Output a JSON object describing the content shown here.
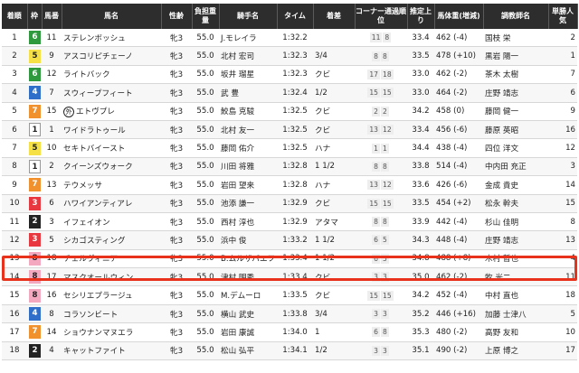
{
  "headers": {
    "rank": "着順",
    "waku": "枠",
    "umaban": "馬番",
    "horse": "馬名",
    "sexage": "性齢",
    "weight": "負担重量",
    "jockey": "騎手名",
    "time": "タイム",
    "margin": "着差",
    "corner": "コーナー通過順位",
    "agari": "推定上り",
    "body": "馬体重(増減)",
    "trainer": "調教師名",
    "pop": "単勝人気"
  },
  "rows": [
    {
      "rank": "1",
      "waku": "6",
      "umaban": "11",
      "name": "ステレンボッシュ",
      "sexage": "牝3",
      "weight": "55.0",
      "jockey": "J.モレイラ",
      "time": "1:32.2",
      "margin": "",
      "corner": [
        "11",
        "8"
      ],
      "agari": "33.4",
      "body": "462",
      "diff": "(-4)",
      "trainer": "国枝 栄",
      "pop": "2"
    },
    {
      "rank": "2",
      "waku": "5",
      "umaban": "9",
      "name": "アスコリピチェーノ",
      "sexage": "牝3",
      "weight": "55.0",
      "jockey": "北村 宏司",
      "time": "1:32.3",
      "margin": "3/4",
      "corner": [
        "8",
        "8"
      ],
      "agari": "33.5",
      "body": "478",
      "diff": "(+10)",
      "trainer": "黒岩 陽一",
      "pop": "1"
    },
    {
      "rank": "3",
      "waku": "6",
      "umaban": "12",
      "name": "ライトバック",
      "sexage": "牝3",
      "weight": "55.0",
      "jockey": "坂井 瑠星",
      "time": "1:32.3",
      "margin": "クビ",
      "corner": [
        "17",
        "18"
      ],
      "agari": "33.0",
      "body": "462",
      "diff": "(-2)",
      "trainer": "茶木 太樹",
      "pop": "7"
    },
    {
      "rank": "4",
      "waku": "4",
      "umaban": "7",
      "name": "スウィープフィート",
      "sexage": "牝3",
      "weight": "55.0",
      "jockey": "武 豊",
      "time": "1:32.4",
      "margin": "1/2",
      "corner": [
        "15",
        "15"
      ],
      "agari": "33.0",
      "body": "464",
      "diff": "(-2)",
      "trainer": "庄野 靖志",
      "pop": "6"
    },
    {
      "rank": "5",
      "waku": "7",
      "umaban": "15",
      "name": "エトヴプレ",
      "badge": "外",
      "sexage": "牝3",
      "weight": "55.0",
      "jockey": "鮫島 克駿",
      "time": "1:32.5",
      "margin": "クビ",
      "corner": [
        "2",
        "2"
      ],
      "agari": "34.2",
      "body": "458",
      "diff": "(0)",
      "trainer": "藤岡 健一",
      "pop": "9"
    },
    {
      "rank": "6",
      "waku": "1",
      "umaban": "1",
      "name": "ワイドラトゥール",
      "sexage": "牝3",
      "weight": "55.0",
      "jockey": "北村 友一",
      "time": "1:32.5",
      "margin": "クビ",
      "corner": [
        "13",
        "12"
      ],
      "agari": "33.4",
      "body": "456",
      "diff": "(-6)",
      "trainer": "藤原 英昭",
      "pop": "16"
    },
    {
      "rank": "7",
      "waku": "5",
      "umaban": "10",
      "name": "セキトバイースト",
      "sexage": "牝3",
      "weight": "55.0",
      "jockey": "藤岡 佑介",
      "time": "1:32.5",
      "margin": "ハナ",
      "corner": [
        "1",
        "1"
      ],
      "agari": "34.4",
      "body": "438",
      "diff": "(-4)",
      "trainer": "四位 洋文",
      "pop": "12"
    },
    {
      "rank": "8",
      "waku": "1",
      "umaban": "2",
      "name": "クイーンズウォーク",
      "sexage": "牝3",
      "weight": "55.0",
      "jockey": "川田 将雅",
      "time": "1:32.8",
      "margin": "1 1/2",
      "corner": [
        "8",
        "8"
      ],
      "agari": "33.8",
      "body": "514",
      "diff": "(-4)",
      "trainer": "中内田 充正",
      "pop": "3"
    },
    {
      "rank": "9",
      "waku": "7",
      "umaban": "13",
      "name": "テウメッサ",
      "sexage": "牝3",
      "weight": "55.0",
      "jockey": "岩田 望来",
      "time": "1:32.8",
      "margin": "ハナ",
      "corner": [
        "13",
        "12"
      ],
      "agari": "33.6",
      "body": "426",
      "diff": "(-6)",
      "trainer": "金成 貴史",
      "pop": "14"
    },
    {
      "rank": "10",
      "waku": "3",
      "umaban": "6",
      "name": "ハワイアンティアレ",
      "sexage": "牝3",
      "weight": "55.0",
      "jockey": "池添 謙一",
      "time": "1:32.9",
      "margin": "クビ",
      "corner": [
        "15",
        "15"
      ],
      "agari": "33.5",
      "body": "454",
      "diff": "(+2)",
      "trainer": "松永 幹夫",
      "pop": "15"
    },
    {
      "rank": "11",
      "waku": "2",
      "umaban": "3",
      "name": "イフェイオン",
      "sexage": "牝3",
      "weight": "55.0",
      "jockey": "西村 淳也",
      "time": "1:32.9",
      "margin": "アタマ",
      "corner": [
        "8",
        "8"
      ],
      "agari": "33.9",
      "body": "442",
      "diff": "(-4)",
      "trainer": "杉山 佳明",
      "pop": "8"
    },
    {
      "rank": "12",
      "waku": "3",
      "umaban": "5",
      "name": "シカゴスティング",
      "sexage": "牝3",
      "weight": "55.0",
      "jockey": "浜中 俊",
      "time": "1:33.2",
      "margin": "1 1/2",
      "corner": [
        "6",
        "5"
      ],
      "agari": "34.3",
      "body": "448",
      "diff": "(-4)",
      "trainer": "庄野 靖志",
      "pop": "13"
    },
    {
      "rank": "13",
      "waku": "8",
      "umaban": "18",
      "name": "チェルヴィニア",
      "sexage": "牝3",
      "weight": "55.0",
      "jockey": "B.ムルザバエフ",
      "time": "1:33.4",
      "margin": "1 1/2",
      "corner": [
        "6",
        "5"
      ],
      "agari": "34.8",
      "body": "488",
      "diff": "(+8)",
      "trainer": "木村 哲也",
      "pop": "4"
    },
    {
      "rank": "14",
      "waku": "8",
      "umaban": "17",
      "name": "マスクオールウィン",
      "sexage": "牝3",
      "weight": "55.0",
      "jockey": "津村 明秀",
      "time": "1:33.4",
      "margin": "クビ",
      "corner": [
        "3",
        "3"
      ],
      "agari": "35.0",
      "body": "462",
      "diff": "(-2)",
      "trainer": "牧 光二",
      "pop": "11"
    },
    {
      "rank": "15",
      "waku": "8",
      "umaban": "16",
      "name": "セシリエプラージュ",
      "sexage": "牝3",
      "weight": "55.0",
      "jockey": "M.デムーロ",
      "time": "1:33.5",
      "margin": "クビ",
      "corner": [
        "15",
        "15"
      ],
      "agari": "34.2",
      "body": "452",
      "diff": "(-4)",
      "trainer": "中村 直也",
      "pop": "18"
    },
    {
      "rank": "16",
      "waku": "4",
      "umaban": "8",
      "name": "コラソンビート",
      "sexage": "牝3",
      "weight": "55.0",
      "jockey": "横山 武史",
      "time": "1:33.8",
      "margin": "3/4",
      "corner": [
        "3",
        "3"
      ],
      "agari": "35.2",
      "body": "446",
      "diff": "(+16)",
      "trainer": "加藤 士津八",
      "pop": "5"
    },
    {
      "rank": "17",
      "waku": "7",
      "umaban": "14",
      "name": "ショウナンマヌエラ",
      "sexage": "牝3",
      "weight": "55.0",
      "jockey": "岩田 康誠",
      "time": "1:34.0",
      "margin": "1",
      "corner": [
        "6",
        "8"
      ],
      "agari": "35.3",
      "body": "480",
      "diff": "(-2)",
      "trainer": "高野 友和",
      "pop": "10"
    },
    {
      "rank": "18",
      "waku": "2",
      "umaban": "4",
      "name": "キャットファイト",
      "sexage": "牝3",
      "weight": "55.0",
      "jockey": "松山 弘平",
      "time": "1:34.1",
      "margin": "1/2",
      "corner": [
        "3",
        "3"
      ],
      "agari": "35.1",
      "body": "490",
      "diff": "(-2)",
      "trainer": "上原 博之",
      "pop": "17"
    }
  ],
  "highlight_color": "#e8321c"
}
